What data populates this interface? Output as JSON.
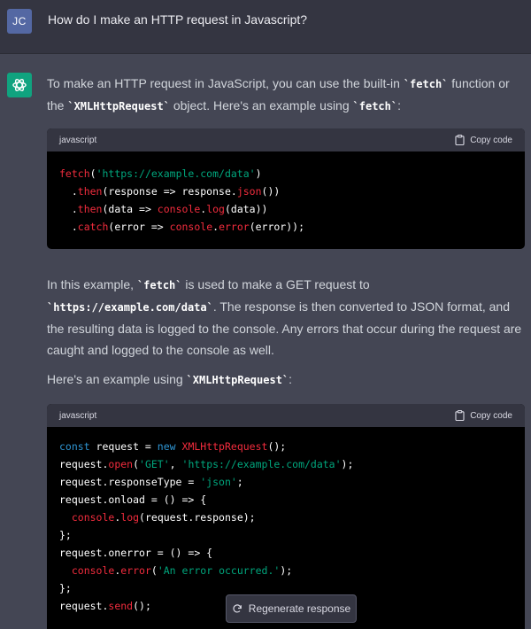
{
  "user": {
    "initials": "JC",
    "question": "How do I make an HTTP request in Javascript?"
  },
  "assistant": {
    "p1": {
      "t1": "To make an HTTP request in JavaScript, you can use the built-in ",
      "c1": "`fetch`",
      "t2": " function or the ",
      "c2": "`XMLHttpRequest`",
      "t3": " object. Here's an example using ",
      "c3": "`fetch`",
      "t4": ":"
    },
    "p2": {
      "t1": "In this example, ",
      "c1": "`fetch`",
      "t2": " is used to make a GET request to ",
      "c2": "`https://example.com/data`",
      "t3": ". The response is then converted to JSON format, and the resulting data is logged to the console. Any errors that occur during the request are caught and logged to the console as well."
    },
    "p3": {
      "t1": "Here's an example using ",
      "c1": "`XMLHttpRequest`",
      "t2": ":"
    },
    "code_blocks": [
      {
        "language": "javascript",
        "copy_label": "Copy code",
        "lines": [
          [
            {
              "t": "fetch",
              "c": "fn"
            },
            {
              "t": "(",
              "c": "pl"
            },
            {
              "t": "'https://example.com/data'",
              "c": "str"
            },
            {
              "t": ")",
              "c": "pl"
            }
          ],
          [
            {
              "t": "  .",
              "c": "pl"
            },
            {
              "t": "then",
              "c": "fn"
            },
            {
              "t": "(response => response.",
              "c": "pl"
            },
            {
              "t": "json",
              "c": "fn"
            },
            {
              "t": "())",
              "c": "pl"
            }
          ],
          [
            {
              "t": "  .",
              "c": "pl"
            },
            {
              "t": "then",
              "c": "fn"
            },
            {
              "t": "(data => ",
              "c": "pl"
            },
            {
              "t": "console",
              "c": "fn"
            },
            {
              "t": ".",
              "c": "pl"
            },
            {
              "t": "log",
              "c": "fn"
            },
            {
              "t": "(data))",
              "c": "pl"
            }
          ],
          [
            {
              "t": "  .",
              "c": "pl"
            },
            {
              "t": "catch",
              "c": "fn"
            },
            {
              "t": "(error => ",
              "c": "pl"
            },
            {
              "t": "console",
              "c": "fn"
            },
            {
              "t": ".",
              "c": "pl"
            },
            {
              "t": "error",
              "c": "fn"
            },
            {
              "t": "(error));",
              "c": "pl"
            }
          ]
        ]
      },
      {
        "language": "javascript",
        "copy_label": "Copy code",
        "lines": [
          [
            {
              "t": "const",
              "c": "kw"
            },
            {
              "t": " request = ",
              "c": "pl"
            },
            {
              "t": "new",
              "c": "kw"
            },
            {
              "t": " ",
              "c": "pl"
            },
            {
              "t": "XMLHttpRequest",
              "c": "fn"
            },
            {
              "t": "();",
              "c": "pl"
            }
          ],
          [
            {
              "t": "request.",
              "c": "pl"
            },
            {
              "t": "open",
              "c": "fn"
            },
            {
              "t": "(",
              "c": "pl"
            },
            {
              "t": "'GET'",
              "c": "str"
            },
            {
              "t": ", ",
              "c": "pl"
            },
            {
              "t": "'https://example.com/data'",
              "c": "str"
            },
            {
              "t": ");",
              "c": "pl"
            }
          ],
          [
            {
              "t": "request.responseType = ",
              "c": "pl"
            },
            {
              "t": "'json'",
              "c": "str"
            },
            {
              "t": ";",
              "c": "pl"
            }
          ],
          [
            {
              "t": "request.onload = () => {",
              "c": "pl"
            }
          ],
          [
            {
              "t": "  ",
              "c": "pl"
            },
            {
              "t": "console",
              "c": "fn"
            },
            {
              "t": ".",
              "c": "pl"
            },
            {
              "t": "log",
              "c": "fn"
            },
            {
              "t": "(request.response);",
              "c": "pl"
            }
          ],
          [
            {
              "t": "};",
              "c": "pl"
            }
          ],
          [
            {
              "t": "request.onerror = () => {",
              "c": "pl"
            }
          ],
          [
            {
              "t": "  ",
              "c": "pl"
            },
            {
              "t": "console",
              "c": "fn"
            },
            {
              "t": ".",
              "c": "pl"
            },
            {
              "t": "error",
              "c": "fn"
            },
            {
              "t": "(",
              "c": "pl"
            },
            {
              "t": "'An error occurred.'",
              "c": "str"
            },
            {
              "t": ");",
              "c": "pl"
            }
          ],
          [
            {
              "t": "};",
              "c": "pl"
            }
          ],
          [
            {
              "t": "request.",
              "c": "pl"
            },
            {
              "t": "send",
              "c": "fn"
            },
            {
              "t": "();",
              "c": "pl"
            }
          ]
        ]
      }
    ]
  },
  "regenerate_label": "Regenerate response",
  "colors": {
    "user_row_bg": "#343541",
    "assistant_bg": "#444654",
    "user_avatar": "#5468a3",
    "bot_avatar": "#10a37f",
    "code_bg": "#000000",
    "token_keyword": "#2e95d3",
    "token_function": "#f22c3d",
    "token_string": "#00a67d"
  },
  "icons": {
    "bot_avatar": "openai-logo-icon",
    "copy": "clipboard-icon",
    "regenerate": "refresh-icon"
  }
}
